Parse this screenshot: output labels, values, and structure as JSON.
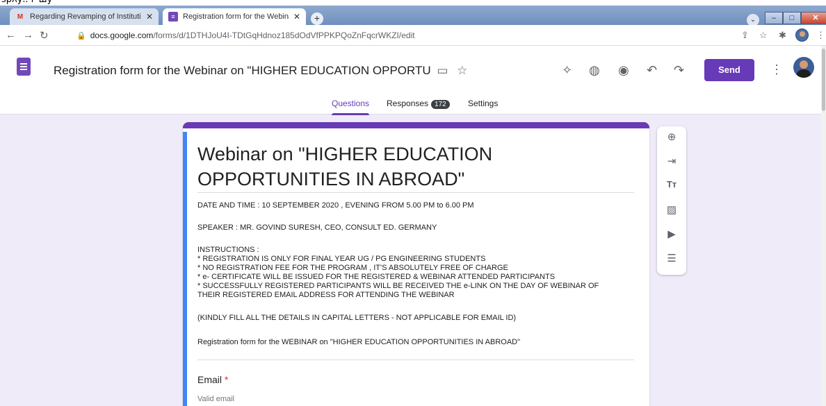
{
  "browser": {
    "tabs": [
      {
        "label": "Regarding Revamping of Instituti",
        "icon": "gmail-icon"
      },
      {
        "label": "Registration form for the Webina",
        "icon": "google-forms-icon"
      }
    ],
    "url_host": "docs.google.com",
    "url_path": "/forms/d/1DTHJoU4I-TDtGqHdnoz185dOdVfPPKPQoZnFqcrWKZI/edit"
  },
  "forms_header": {
    "doc_title": "Registration form for the Webinar on \"HIGHER EDUCATION OPPORTU",
    "send_label": "Send",
    "tabs": [
      {
        "label": "Questions"
      },
      {
        "label": "Responses",
        "badge": "172"
      },
      {
        "label": "Settings"
      }
    ]
  },
  "form": {
    "title": "Webinar on \"HIGHER EDUCATION OPPORTUNITIES IN ABROAD\"",
    "description": {
      "date_time": "DATE AND TIME : 10 SEPTEMBER 2020 , EVENING FROM 5.00 PM to 6.00 PM",
      "speaker": "SPEAKER : MR. GOVIND SURESH, CEO, CONSULT ED. GERMANY",
      "instructions_heading": "INSTRUCTIONS :",
      "instructions": [
        "* REGISTRATION IS ONLY FOR FINAL YEAR UG / PG ENGINEERING STUDENTS",
        "* NO REGISTRATION FEE FOR THE PROGRAM , IT'S ABSOLUTELY FREE OF CHARGE",
        "* e- CERTIFICATE WILL BE ISSUED FOR THE REGISTERED & WEBINAR ATTENDED PARTICIPANTS",
        "* SUCCESSFULLY REGISTERED PARTICIPANTS WILL BE RECEIVED THE e-LINK ON THE DAY OF WEBINAR OF",
        "THEIR REGISTERED EMAIL ADDRESS FOR ATTENDING THE WEBINAR"
      ],
      "note": " (KINDLY FILL ALL THE DETAILS IN CAPITAL LETTERS - NOT APPLICABLE FOR EMAIL ID)",
      "subtitle": "Registration form for the WEBINAR on \"HIGHER EDUCATION OPPORTUNITIES IN ABROAD\""
    },
    "question": {
      "label": "Email",
      "required_mark": "*",
      "placeholder": "Valid email"
    }
  },
  "colors": {
    "accent": "#673ab7",
    "page_background": "#f0ebf8",
    "required": "#d93025"
  }
}
